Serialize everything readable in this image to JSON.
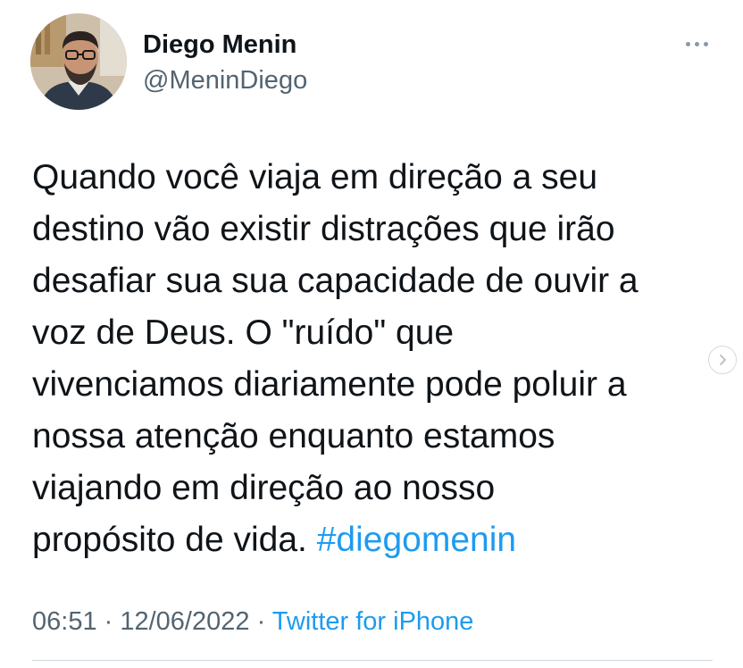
{
  "author": {
    "display_name": "Diego Menin",
    "handle": "@MeninDiego"
  },
  "tweet": {
    "lines": [
      "Quando você viaja em direção a seu",
      "destino vão existir distrações que irão",
      "desafiar sua sua capacidade de ouvir a",
      "voz de Deus. O \"ruído\" que",
      "vivenciamos diariamente pode poluir a",
      "nossa atenção enquanto estamos",
      "viajando em direção ao nosso",
      "propósito de vida."
    ],
    "hashtag": "#diegomenin"
  },
  "meta": {
    "time": "06:51",
    "separator_1": " · ",
    "date": "12/06/2022",
    "separator_2": " · ",
    "source": "Twitter for iPhone"
  },
  "icons": {
    "more": "more-horizontal-icon",
    "next": "chevron-right-icon"
  },
  "colors": {
    "accent": "#1d9bf0",
    "text": "#0f1419",
    "secondary_text": "#536471"
  }
}
